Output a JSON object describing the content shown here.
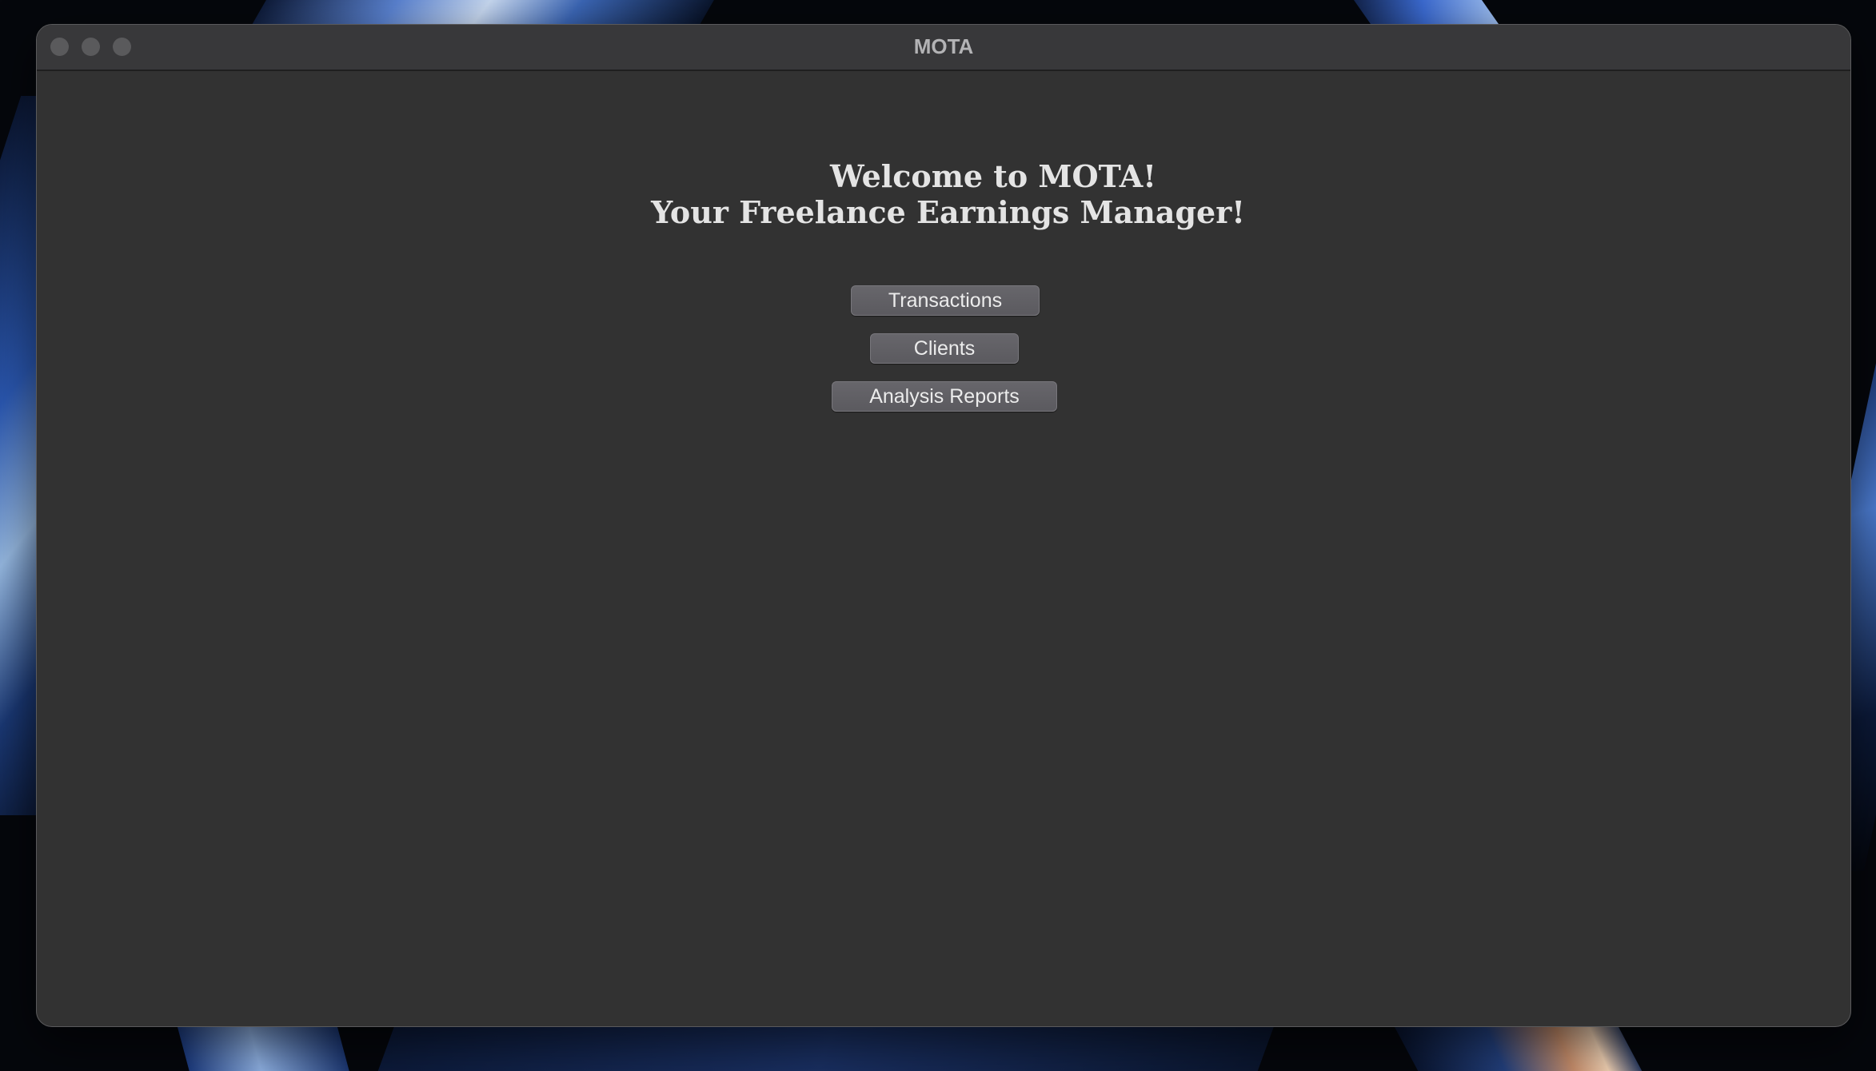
{
  "window": {
    "title": "MOTA"
  },
  "welcome": {
    "line1": "Welcome to MOTA!",
    "line2": "Your Freelance Earnings Manager!"
  },
  "menu": {
    "transactions_label": "Transactions",
    "clients_label": "Clients",
    "analysis_reports_label": "Analysis Reports"
  },
  "colors": {
    "window_background": "#323232",
    "titlebar_background": "#38383a",
    "button_background": "#5f5e63",
    "heading_text": "#e4e4e4"
  }
}
